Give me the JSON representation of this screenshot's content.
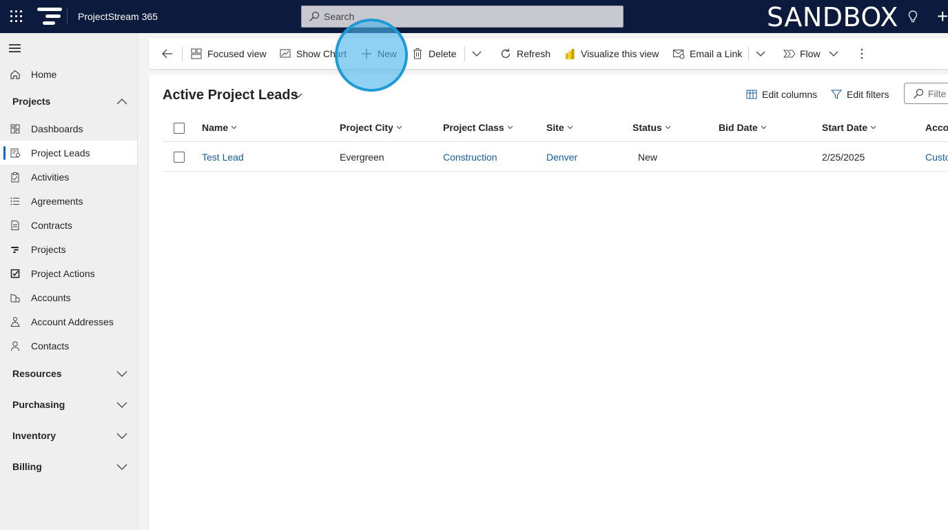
{
  "topbar": {
    "app_title": "ProjectStream 365",
    "search_placeholder": "Search",
    "environment_label": "SANDBOX",
    "plus_symbol": "+"
  },
  "sidebar": {
    "home": "Home",
    "projects_group": "Projects",
    "items": [
      {
        "label": "Dashboards",
        "icon": "dashboard-icon"
      },
      {
        "label": "Project Leads",
        "icon": "project-leads-icon",
        "selected": true
      },
      {
        "label": "Activities",
        "icon": "clipboard-icon"
      },
      {
        "label": "Agreements",
        "icon": "list-icon"
      },
      {
        "label": "Contracts",
        "icon": "document-icon"
      },
      {
        "label": "Projects",
        "icon": "projects-icon"
      },
      {
        "label": "Project Actions",
        "icon": "checkbox-icon"
      },
      {
        "label": "Accounts",
        "icon": "accounts-icon"
      },
      {
        "label": "Account Addresses",
        "icon": "address-icon"
      },
      {
        "label": "Contacts",
        "icon": "person-icon"
      }
    ],
    "groups": [
      "Resources",
      "Purchasing",
      "Inventory",
      "Billing"
    ]
  },
  "commandbar": {
    "focused_view": "Focused view",
    "show_chart": "Show Chart",
    "new": "New",
    "delete": "Delete",
    "refresh": "Refresh",
    "visualize": "Visualize this view",
    "email_link": "Email a Link",
    "flow": "Flow"
  },
  "view": {
    "title": "Active Project Leads",
    "edit_columns": "Edit columns",
    "edit_filters": "Edit filters",
    "filter_placeholder": "Filte"
  },
  "grid": {
    "columns": [
      "Name",
      "Project City",
      "Project Class",
      "Site",
      "Status",
      "Bid Date",
      "Start Date",
      "Acco"
    ],
    "rows": [
      {
        "name": "Test Lead",
        "city": "Evergreen",
        "class": "Construction",
        "site": "Denver",
        "status": "New",
        "bid_date": "",
        "start_date": "2/25/2025",
        "account": "Custo"
      }
    ]
  },
  "colors": {
    "topbar": "#0b1a3d",
    "accent": "#0f6cbd",
    "link": "#115ea3",
    "highlight": "#1e9ad6"
  }
}
